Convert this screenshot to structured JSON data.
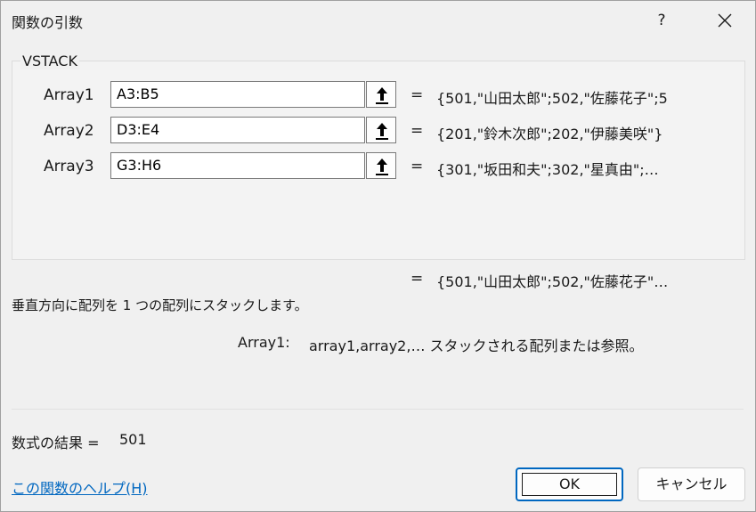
{
  "dialog": {
    "title": "関数の引数",
    "help_glyph": "?",
    "close_glyph": "✕"
  },
  "function": {
    "name": "VSTACK",
    "arguments": [
      {
        "label": "Array1",
        "value": "A3:B5",
        "equals": "=",
        "result": "{501,\"山田太郎\";502,\"佐藤花子\";5"
      },
      {
        "label": "Array2",
        "value": "D3:E4",
        "equals": "=",
        "result": "{201,\"鈴木次郎\";202,\"伊藤美咲\"}"
      },
      {
        "label": "Array3",
        "value": "G3:H6",
        "equals": "=",
        "result": "{301,\"坂田和夫\";302,\"星真由\";…"
      }
    ],
    "overall_equals": "=",
    "overall_result": "{501,\"山田太郎\";502,\"佐藤花子\"…",
    "description": "垂直方向に配列を 1 つの配列にスタックします。",
    "arg_desc_name": "Array1:",
    "arg_desc_text": "array1,array2,… スタックされる配列または参照。"
  },
  "formula_result": {
    "label": "数式の結果 =",
    "value": "501"
  },
  "help_link": "この関数のヘルプ(H)",
  "buttons": {
    "ok": "OK",
    "cancel": "キャンセル"
  }
}
